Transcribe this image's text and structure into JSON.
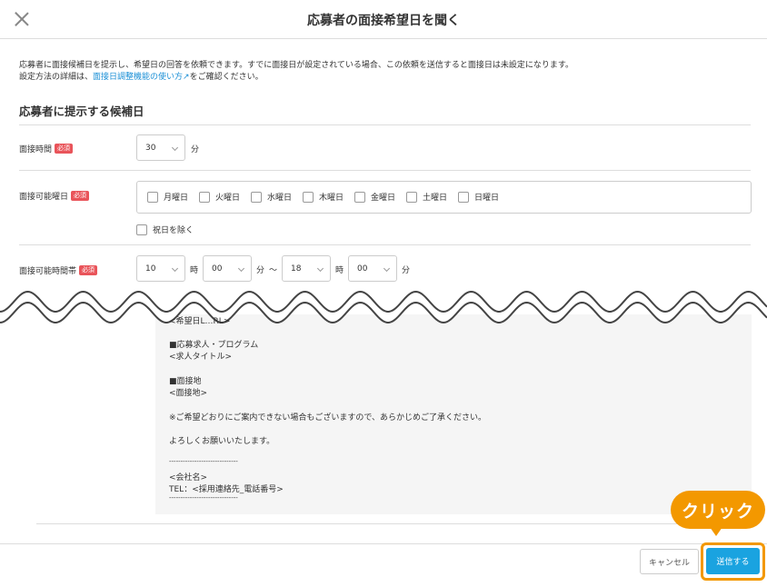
{
  "header": {
    "title": "応募者の面接希望日を聞く"
  },
  "description": {
    "line1": "応募者に面接候補日を提示し、希望日の回答を依頼できます。すでに面接日が設定されている場合、この依頼を送信すると面接日は未設定になります。",
    "line2_prefix": "設定方法の詳細は、",
    "line2_link": "面接日調整機能の使い方",
    "line2_suffix": "をご確認ください。"
  },
  "section": {
    "title": "応募者に提示する候補日"
  },
  "required_badge": "必須",
  "duration": {
    "label": "面接時間",
    "value": "30",
    "unit": "分"
  },
  "weekdays": {
    "label": "面接可能曜日",
    "days": [
      "月曜日",
      "火曜日",
      "水曜日",
      "木曜日",
      "金曜日",
      "土曜日",
      "日曜日"
    ],
    "exclude_holidays": "祝日を除く"
  },
  "timerange": {
    "label": "面接可能時間帯",
    "start_hour": "10",
    "start_min": "00",
    "end_hour": "18",
    "end_min": "00",
    "hour_unit": "時",
    "min_unit": "分",
    "tilde": "〜"
  },
  "mail_preview": {
    "lines": [
      "<希望日L…RL>",
      "■応募求人・プログラム",
      "<求人タイトル>",
      "■面接地",
      "<面接地>",
      "※ご希望どおりにご案内できない場合もございますので、あらかじめご了承ください。",
      "よろしくお願いいたします。",
      "------------------------------",
      "<会社名>",
      "TEL：<採用連絡先_電話番号>",
      "------------------------------"
    ]
  },
  "footer": {
    "cancel_label": "キャンセル",
    "send_label": "送信する"
  },
  "callout": {
    "text": "クリック"
  },
  "colors": {
    "accent": "#1aa3e0",
    "highlight": "#f39800",
    "required": "#e9545a",
    "link": "#1a8fd6"
  }
}
